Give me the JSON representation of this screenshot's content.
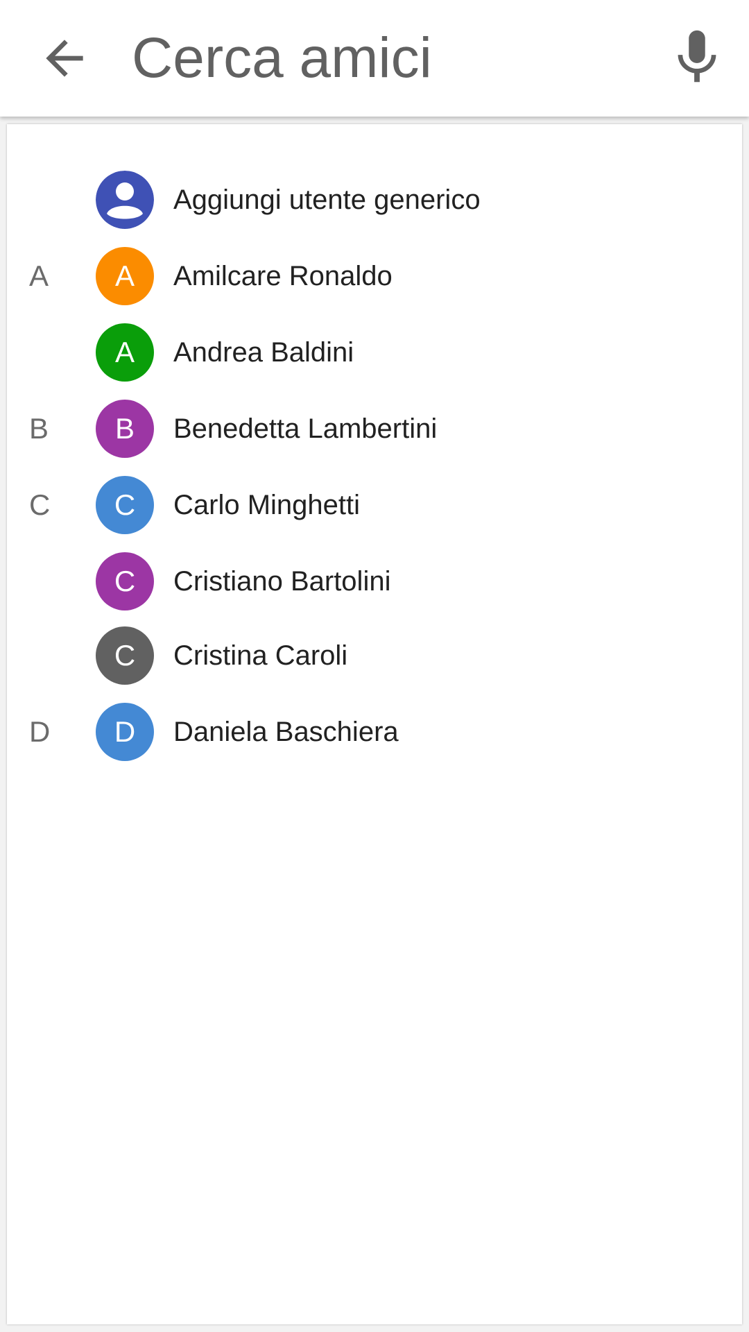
{
  "search": {
    "placeholder": "Cerca amici",
    "value": "",
    "back_icon": "arrow-left-icon",
    "mic_icon": "microphone-icon"
  },
  "colors": {
    "generic_user": "#3f51b5",
    "orange": "#fb8c00",
    "green": "#0a9e0a",
    "purple": "#9c36a4",
    "blue": "#4489d4",
    "gray": "#616161"
  },
  "contacts": [
    {
      "section": "",
      "initial": "",
      "name": "Aggiungi utente generico",
      "icon": "person-icon",
      "color": "#3f51b5"
    },
    {
      "section": "A",
      "initial": "A",
      "name": "Amilcare Ronaldo",
      "color": "#fb8c00"
    },
    {
      "section": "",
      "initial": "A",
      "name": "Andrea Baldini",
      "color": "#0a9e0a"
    },
    {
      "section": "B",
      "initial": "B",
      "name": "Benedetta Lambertini",
      "color": "#9c36a4"
    },
    {
      "section": "C",
      "initial": "C",
      "name": "Carlo Minghetti",
      "color": "#4489d4"
    },
    {
      "section": "",
      "initial": "C",
      "name": "Cristiano Bartolini",
      "color": "#9c36a4"
    },
    {
      "section": "",
      "initial": "C",
      "name": "Cristina Caroli",
      "color": "#616161"
    },
    {
      "section": "D",
      "initial": "D",
      "name": "Daniela Baschiera",
      "color": "#4489d4"
    }
  ]
}
